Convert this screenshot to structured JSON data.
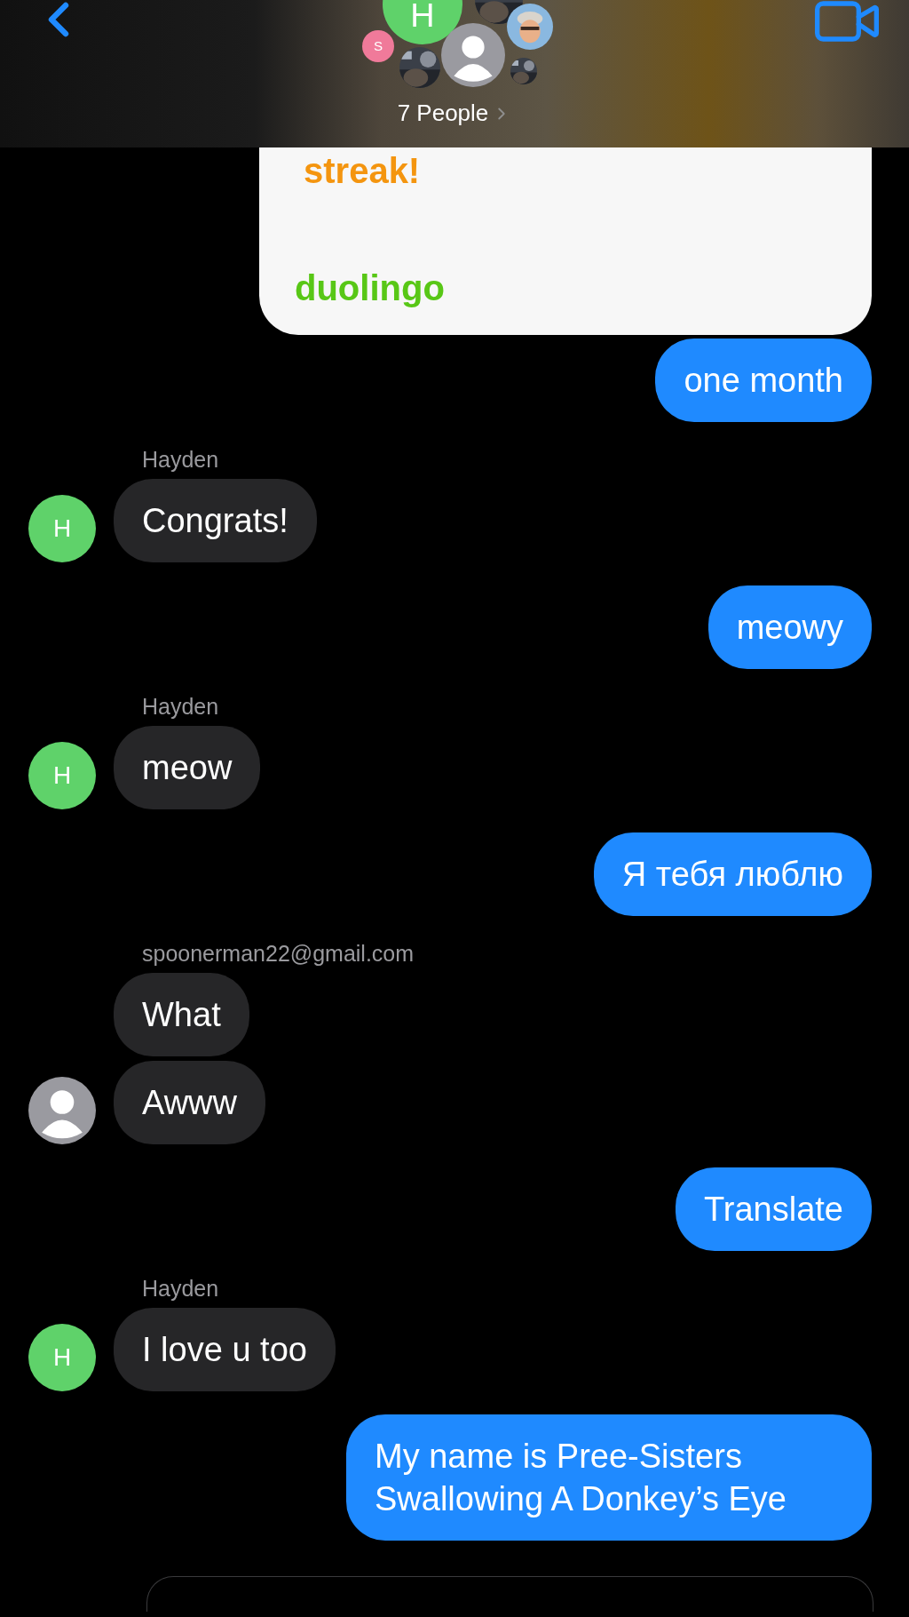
{
  "header": {
    "avatars": [
      {
        "kind": "letter",
        "initial": "H",
        "color": "#5fd26a"
      },
      {
        "kind": "picture"
      },
      {
        "kind": "memoji",
        "color": "#8ab8e0"
      },
      {
        "kind": "letter",
        "initial": "S",
        "color": "#f07a9a"
      },
      {
        "kind": "picture"
      },
      {
        "kind": "silhouette",
        "color": "#9a9aa0"
      },
      {
        "kind": "picture"
      }
    ],
    "title": "7 People"
  },
  "messages": [
    {
      "kind": "card",
      "headline": "streak!",
      "brand": "duolingo"
    },
    {
      "kind": "outgoing",
      "text": "one month"
    },
    {
      "kind": "incoming",
      "sender": "Hayden",
      "text": "Congrats!",
      "avatar": {
        "kind": "letter",
        "initial": "H",
        "color": "#5fd26a"
      }
    },
    {
      "kind": "outgoing",
      "text": "meowy"
    },
    {
      "kind": "incoming",
      "sender": "Hayden",
      "text": "meow",
      "avatar": {
        "kind": "letter",
        "initial": "H",
        "color": "#5fd26a"
      }
    },
    {
      "kind": "outgoing",
      "text": "Я тебя люблю"
    },
    {
      "kind": "incoming",
      "sender": "spoonerman22@gmail.com",
      "text": "What"
    },
    {
      "kind": "incoming",
      "text": "Awww",
      "avatar": {
        "kind": "silhouette",
        "color": "#9a9aa0"
      }
    },
    {
      "kind": "outgoing",
      "text": "Translate"
    },
    {
      "kind": "incoming",
      "sender": "Hayden",
      "text": "I love u too",
      "avatar": {
        "kind": "letter",
        "initial": "H",
        "color": "#5fd26a"
      }
    },
    {
      "kind": "outgoing",
      "text": "My name is Pree-Sisters Swallowing A Donkey’s Eye"
    }
  ]
}
